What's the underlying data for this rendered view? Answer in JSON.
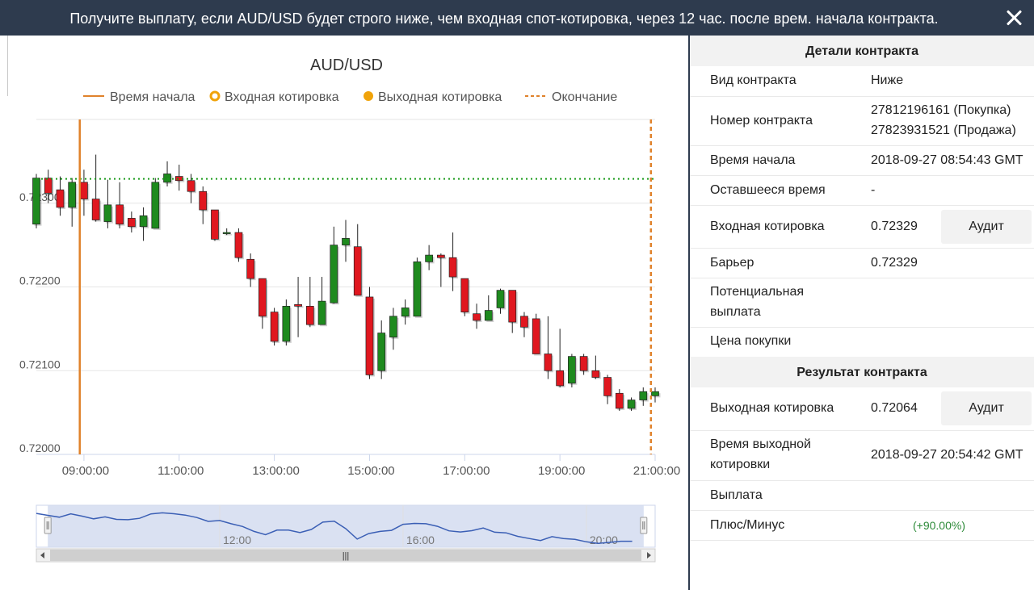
{
  "header": {
    "title": "Получите выплату, если AUD/USD будет строго ниже, чем входная спот-котировка, через 12 час. после врем. начала контракта."
  },
  "chart_data": {
    "type": "candlestick",
    "title": "AUD/USD",
    "legend": [
      {
        "name": "Время начала",
        "color": "#e0822b",
        "style": "line"
      },
      {
        "name": "Входная котировка",
        "color": "#f0a30a",
        "style": "ring"
      },
      {
        "name": "Выходная котировка",
        "color": "#f0a30a",
        "style": "dot"
      },
      {
        "name": "Окончание",
        "color": "#e0822b",
        "style": "dashed"
      }
    ],
    "legend_position": "top",
    "grid": true,
    "colors": {
      "up": "#1e8a1e",
      "down": "#e0171f",
      "start_line": "#e0822b",
      "end_line": "#e0822b",
      "barrier": "#1a9a1a",
      "navigator_line": "#3b5fb5",
      "navigator_fill": "#d3dcf0"
    },
    "ylim": [
      0.72,
      0.724
    ],
    "y_ticks": [
      "0.72000",
      "0.72100",
      "0.72200",
      "0.72300"
    ],
    "y_tick_values": [
      0.72,
      0.721,
      0.722,
      0.723
    ],
    "x_ticks": [
      "09:00:00",
      "11:00:00",
      "13:00:00",
      "15:00:00",
      "17:00:00",
      "19:00:00",
      "21:00:00"
    ],
    "x_tick_hours": [
      9,
      11,
      13,
      15,
      17,
      19,
      21
    ],
    "xlim_hours": [
      8.0,
      21.0
    ],
    "start_time_hours": 8.9119,
    "end_time_hours": 20.9117,
    "barrier": 0.72329,
    "candle_interval_minutes": 15,
    "candles": [
      {
        "t": 8.0,
        "o": 0.72275,
        "h": 0.72335,
        "l": 0.7227,
        "c": 0.7233
      },
      {
        "t": 8.25,
        "o": 0.7233,
        "h": 0.7234,
        "l": 0.723,
        "c": 0.72312
      },
      {
        "t": 8.5,
        "o": 0.72316,
        "h": 0.72332,
        "l": 0.72285,
        "c": 0.72295
      },
      {
        "t": 8.75,
        "o": 0.72295,
        "h": 0.7233,
        "l": 0.72272,
        "c": 0.72325
      },
      {
        "t": 9.0,
        "o": 0.72325,
        "h": 0.7234,
        "l": 0.72285,
        "c": 0.72305
      },
      {
        "t": 9.25,
        "o": 0.72305,
        "h": 0.72358,
        "l": 0.72278,
        "c": 0.7228
      },
      {
        "t": 9.5,
        "o": 0.72278,
        "h": 0.72328,
        "l": 0.7227,
        "c": 0.72298
      },
      {
        "t": 9.75,
        "o": 0.72298,
        "h": 0.72325,
        "l": 0.7227,
        "c": 0.72275
      },
      {
        "t": 10.0,
        "o": 0.72282,
        "h": 0.7229,
        "l": 0.72265,
        "c": 0.72272
      },
      {
        "t": 10.25,
        "o": 0.72272,
        "h": 0.72295,
        "l": 0.72255,
        "c": 0.72285
      },
      {
        "t": 10.5,
        "o": 0.7227,
        "h": 0.7233,
        "l": 0.7227,
        "c": 0.72325
      },
      {
        "t": 10.75,
        "o": 0.72325,
        "h": 0.7235,
        "l": 0.7232,
        "c": 0.72335
      },
      {
        "t": 11.0,
        "o": 0.72332,
        "h": 0.72346,
        "l": 0.72315,
        "c": 0.72327
      },
      {
        "t": 11.25,
        "o": 0.72327,
        "h": 0.72335,
        "l": 0.723,
        "c": 0.72314
      },
      {
        "t": 11.5,
        "o": 0.72314,
        "h": 0.7232,
        "l": 0.72275,
        "c": 0.72292
      },
      {
        "t": 11.75,
        "o": 0.72292,
        "h": 0.72292,
        "l": 0.72255,
        "c": 0.72257
      },
      {
        "t": 12.0,
        "o": 0.72265,
        "h": 0.7227,
        "l": 0.72262,
        "c": 0.72265
      },
      {
        "t": 12.25,
        "o": 0.72265,
        "h": 0.7227,
        "l": 0.7223,
        "c": 0.72235
      },
      {
        "t": 12.5,
        "o": 0.72233,
        "h": 0.7224,
        "l": 0.722,
        "c": 0.7221
      },
      {
        "t": 12.75,
        "o": 0.7221,
        "h": 0.72205,
        "l": 0.7215,
        "c": 0.72165
      },
      {
        "t": 13.0,
        "o": 0.7217,
        "h": 0.72175,
        "l": 0.7213,
        "c": 0.72135
      },
      {
        "t": 13.25,
        "o": 0.72135,
        "h": 0.72185,
        "l": 0.7213,
        "c": 0.72177
      },
      {
        "t": 13.5,
        "o": 0.72179,
        "h": 0.72212,
        "l": 0.7214,
        "c": 0.72177
      },
      {
        "t": 13.75,
        "o": 0.72177,
        "h": 0.72212,
        "l": 0.72152,
        "c": 0.72155
      },
      {
        "t": 14.0,
        "o": 0.72155,
        "h": 0.72212,
        "l": 0.72155,
        "c": 0.72183
      },
      {
        "t": 14.25,
        "o": 0.72181,
        "h": 0.72272,
        "l": 0.7218,
        "c": 0.7225
      },
      {
        "t": 14.5,
        "o": 0.7225,
        "h": 0.7228,
        "l": 0.7223,
        "c": 0.72258
      },
      {
        "t": 14.75,
        "o": 0.72248,
        "h": 0.72275,
        "l": 0.7219,
        "c": 0.7219
      },
      {
        "t": 15.0,
        "o": 0.72188,
        "h": 0.722,
        "l": 0.7209,
        "c": 0.72095
      },
      {
        "t": 15.25,
        "o": 0.721,
        "h": 0.7216,
        "l": 0.7209,
        "c": 0.72145
      },
      {
        "t": 15.5,
        "o": 0.7214,
        "h": 0.72175,
        "l": 0.72125,
        "c": 0.72165
      },
      {
        "t": 15.75,
        "o": 0.72165,
        "h": 0.72185,
        "l": 0.72155,
        "c": 0.72175
      },
      {
        "t": 16.0,
        "o": 0.72165,
        "h": 0.72235,
        "l": 0.72165,
        "c": 0.7223
      },
      {
        "t": 16.25,
        "o": 0.7223,
        "h": 0.7225,
        "l": 0.7222,
        "c": 0.72238
      },
      {
        "t": 16.5,
        "o": 0.72238,
        "h": 0.7224,
        "l": 0.722,
        "c": 0.72235
      },
      {
        "t": 16.75,
        "o": 0.72235,
        "h": 0.72265,
        "l": 0.72195,
        "c": 0.72212
      },
      {
        "t": 17.0,
        "o": 0.7221,
        "h": 0.7221,
        "l": 0.72165,
        "c": 0.7217
      },
      {
        "t": 17.25,
        "o": 0.72168,
        "h": 0.7218,
        "l": 0.7215,
        "c": 0.7216
      },
      {
        "t": 17.5,
        "o": 0.7216,
        "h": 0.7219,
        "l": 0.7216,
        "c": 0.72172
      },
      {
        "t": 17.75,
        "o": 0.72175,
        "h": 0.72198,
        "l": 0.72168,
        "c": 0.72196
      },
      {
        "t": 18.0,
        "o": 0.72196,
        "h": 0.72196,
        "l": 0.72145,
        "c": 0.72158
      },
      {
        "t": 18.25,
        "o": 0.72165,
        "h": 0.7217,
        "l": 0.7214,
        "c": 0.72152
      },
      {
        "t": 18.5,
        "o": 0.72162,
        "h": 0.72168,
        "l": 0.7212,
        "c": 0.7212
      },
      {
        "t": 18.75,
        "o": 0.7212,
        "h": 0.72165,
        "l": 0.7209,
        "c": 0.721
      },
      {
        "t": 19.0,
        "o": 0.721,
        "h": 0.7215,
        "l": 0.7208,
        "c": 0.72082
      },
      {
        "t": 19.25,
        "o": 0.72085,
        "h": 0.7212,
        "l": 0.7208,
        "c": 0.72117
      },
      {
        "t": 19.5,
        "o": 0.72117,
        "h": 0.7212,
        "l": 0.72095,
        "c": 0.721
      },
      {
        "t": 19.75,
        "o": 0.721,
        "h": 0.72118,
        "l": 0.7209,
        "c": 0.72092
      },
      {
        "t": 20.0,
        "o": 0.72092,
        "h": 0.72095,
        "l": 0.7206,
        "c": 0.7207
      },
      {
        "t": 20.25,
        "o": 0.72073,
        "h": 0.72078,
        "l": 0.72052,
        "c": 0.72055
      },
      {
        "t": 20.5,
        "o": 0.72055,
        "h": 0.72068,
        "l": 0.72052,
        "c": 0.72065
      },
      {
        "t": 20.75,
        "o": 0.72065,
        "h": 0.7208,
        "l": 0.72058,
        "c": 0.72075
      },
      {
        "t": 21.0,
        "o": 0.7207,
        "h": 0.7208,
        "l": 0.72062,
        "c": 0.72075
      }
    ],
    "navigator": {
      "x_labels": [
        "12:00",
        "16:00",
        "20:00"
      ],
      "x_label_hours": [
        12,
        16,
        20
      ],
      "selection_hours": [
        8.25,
        21.25
      ],
      "xlim_hours": [
        8.0,
        21.5
      ]
    }
  },
  "details": {
    "title": "Детали контракта",
    "contract_type_label": "Вид контракта",
    "contract_type_value": "Ниже",
    "contract_id_label": "Номер контракта",
    "contract_id_buy": "27812196161 (Покупка)",
    "contract_id_sell": "27823931521 (Продажа)",
    "start_time_label": "Время начала",
    "start_time_value": "2018-09-27 08:54:43 GMT",
    "remaining_label": "Оставшееся время",
    "remaining_value": "-",
    "entry_spot_label": "Входная котировка",
    "entry_spot_value": "0.72329",
    "audit_label": "Аудит",
    "barrier_label": "Барьер",
    "barrier_value": "0.72329",
    "potential_payout_label_1": "Потенциальная",
    "potential_payout_label_2": "выплата",
    "purchase_price_label": "Цена покупки"
  },
  "result": {
    "title": "Результат контракта",
    "exit_spot_label": "Выходная котировка",
    "exit_spot_value": "0.72064",
    "audit_label": "Аудит",
    "exit_time_label_1": "Время выходной",
    "exit_time_label_2": "котировки",
    "exit_time_value": "2018-09-27 20:54:42 GMT",
    "payout_label": "Выплата",
    "profit_label": "Плюс/Минус",
    "profit_value": "(+90.00%)"
  }
}
